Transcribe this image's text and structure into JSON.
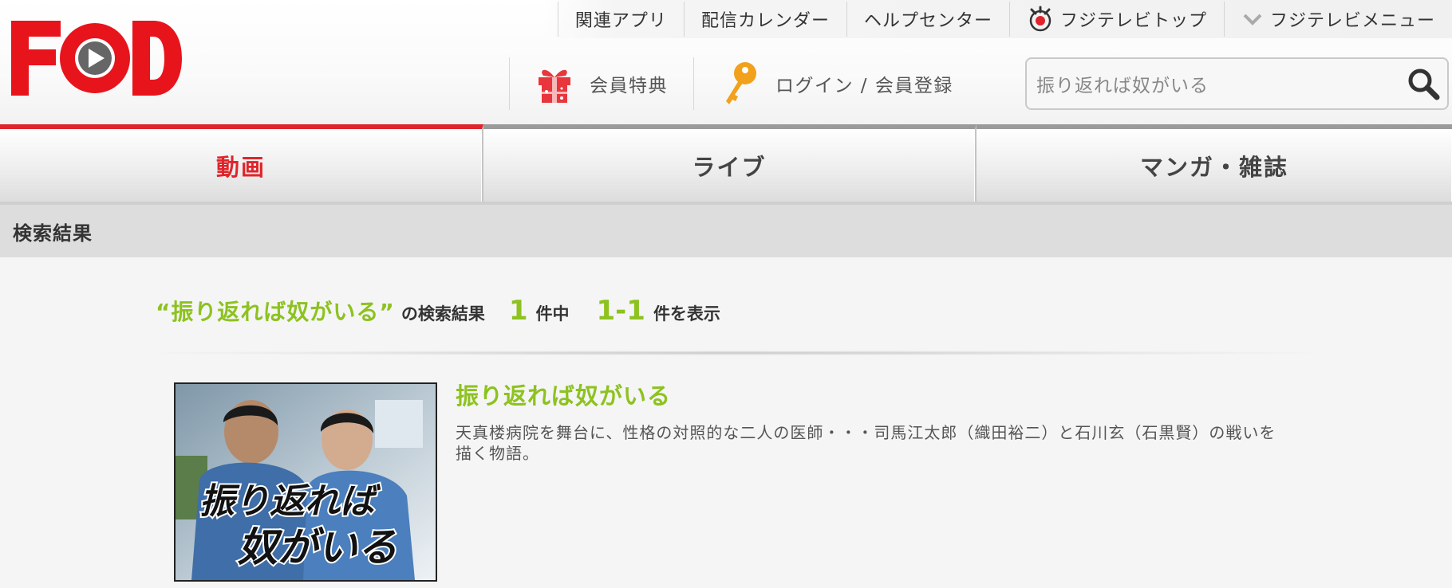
{
  "header": {
    "logo_text": "FOD",
    "top_nav": [
      {
        "label": "関連アプリ",
        "icon": ""
      },
      {
        "label": "配信カレンダー",
        "icon": ""
      },
      {
        "label": "ヘルプセンター",
        "icon": ""
      },
      {
        "label": "フジテレビトップ",
        "icon": "fujitv-eye-icon"
      },
      {
        "label": "フジテレビメニュー",
        "icon": "chevron-down-icon"
      }
    ],
    "member_benefits_label": "会員特典",
    "login_label": "ログイン / 会員登録",
    "search": {
      "value": "振り返れば奴がいる",
      "placeholder": ""
    }
  },
  "tabs": [
    {
      "label": "動画",
      "active": true
    },
    {
      "label": "ライブ",
      "active": false
    },
    {
      "label": "マンガ・雑誌",
      "active": false
    }
  ],
  "section_title": "検索結果",
  "summary": {
    "open_quote": "“",
    "query": "振り返れば奴がいる",
    "close_quote": "”",
    "label_results": "の検索結果",
    "total": "1",
    "label_of": "件中",
    "range": "1-1",
    "label_showing": "件を表示"
  },
  "results": [
    {
      "title": "振り返れば奴がいる",
      "description": "天真楼病院を舞台に、性格の対照的な二人の医師・・・司馬江太郎（織田裕二）と石川玄（石黒賢）の戦いを描く物語。",
      "thumbnail_text_line1": "振り返れば",
      "thumbnail_text_line2": "奴がいる"
    }
  ],
  "colors": {
    "brand_red": "#e0242b",
    "accent_green": "#8dc21f",
    "section_bar": "#dddddd",
    "background": "#f5f5f5"
  }
}
